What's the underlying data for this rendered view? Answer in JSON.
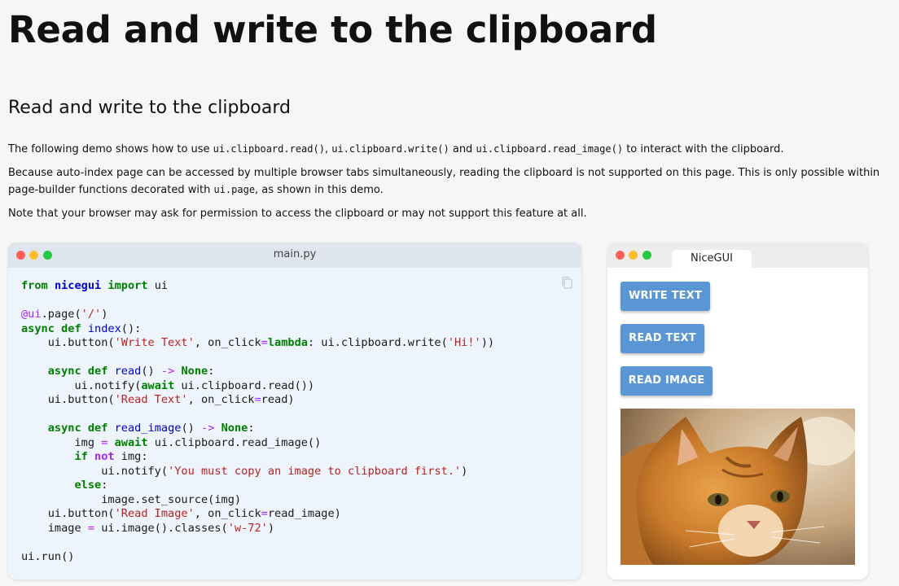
{
  "page": {
    "title": "Read and write to the clipboard",
    "section_title": "Read and write to the clipboard",
    "p1": {
      "t1": "The following demo shows how to use ",
      "c1": "ui.clipboard.read()",
      "t2": ", ",
      "c2": "ui.clipboard.write()",
      "t3": " and ",
      "c3": "ui.clipboard.read_image()",
      "t4": " to interact with the clipboard."
    },
    "p2": {
      "t1": "Because auto-index page can be accessed by multiple browser tabs simultaneously, reading the clipboard is not supported on this page. This is only possible within page-builder functions decorated with ",
      "c1": "ui.page",
      "t2": ", as shown in this demo."
    },
    "p3": "Note that your browser may ask for permission to access the clipboard or may not support this feature at all."
  },
  "code_window": {
    "filename": "main.py",
    "lines": [
      "from nicegui import ui",
      "",
      "@ui.page('/')",
      "async def index():",
      "    ui.button('Write Text', on_click=lambda: ui.clipboard.write('Hi!'))",
      "",
      "    async def read() -> None:",
      "        ui.notify(await ui.clipboard.read())",
      "    ui.button('Read Text', on_click=read)",
      "",
      "    async def read_image() -> None:",
      "        img = await ui.clipboard.read_image()",
      "        if not img:",
      "            ui.notify('You must copy an image to clipboard first.')",
      "        else:",
      "            image.set_source(img)",
      "    ui.button('Read Image', on_click=read_image)",
      "    image = ui.image().classes('w-72')",
      "",
      "ui.run()"
    ],
    "icon": "copy-icon"
  },
  "app_window": {
    "tab_label": "NiceGUI",
    "buttons": {
      "write_text": "WRITE TEXT",
      "read_text": "READ TEXT",
      "read_image": "READ IMAGE"
    },
    "button_color": "#5a96d3",
    "image": "orange tabby cat photo"
  }
}
